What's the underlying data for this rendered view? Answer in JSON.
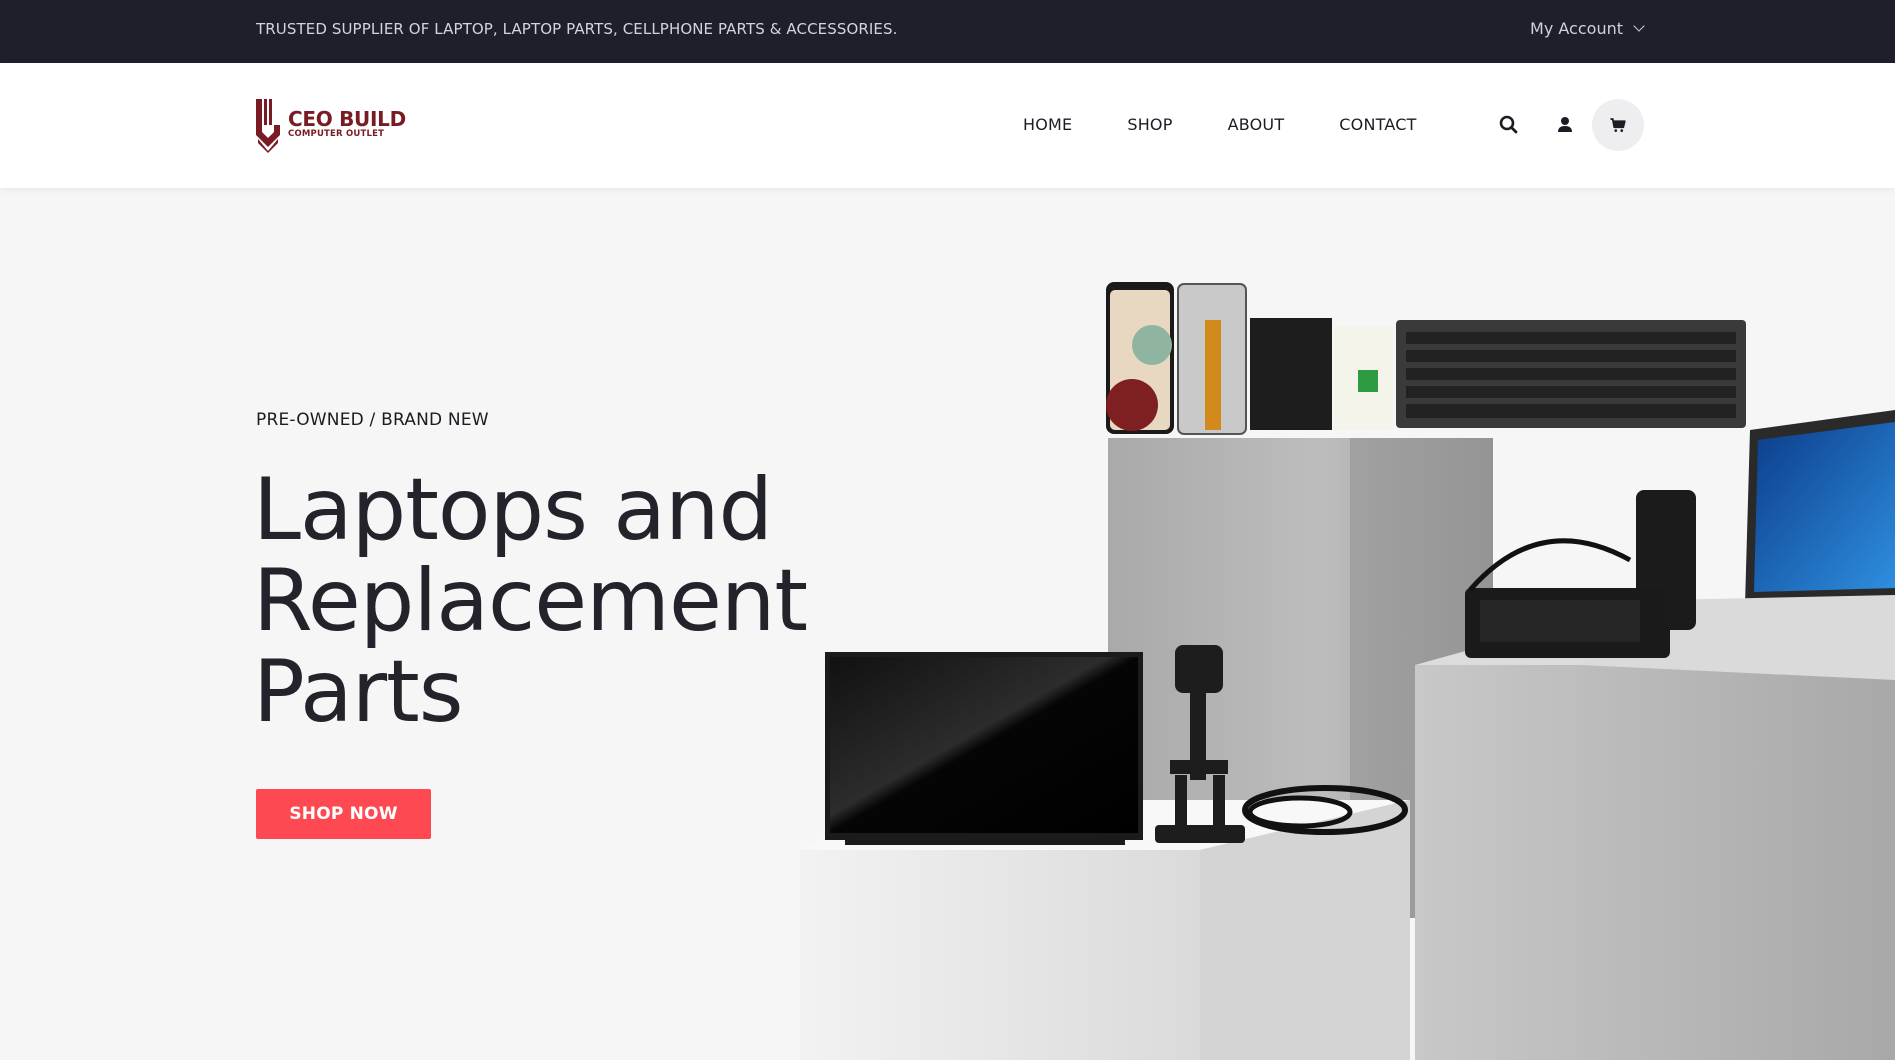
{
  "topbar": {
    "tagline": "TRUSTED SUPPLIER OF LAPTOP, LAPTOP PARTS, CELLPHONE PARTS & ACCESSORIES.",
    "account_label": "My Account"
  },
  "header": {
    "logo": {
      "title": "CEO BUILD",
      "subtitle": "COMPUTER OUTLET"
    },
    "nav": [
      {
        "label": "HOME"
      },
      {
        "label": "SHOP"
      },
      {
        "label": "ABOUT"
      },
      {
        "label": "CONTACT"
      }
    ],
    "icons": [
      "search-icon",
      "user-icon",
      "cart-icon"
    ]
  },
  "hero": {
    "eyebrow": "PRE-OWNED / BRAND NEW",
    "title_lines": [
      "Laptops and",
      "Replacement",
      "Parts"
    ],
    "cta_label": "SHOP NOW"
  },
  "colors": {
    "topbar_bg": "#1e1f2b",
    "brand": "#7a1a22",
    "cta": "#ff4952",
    "page_bg": "#f6f6f6"
  }
}
